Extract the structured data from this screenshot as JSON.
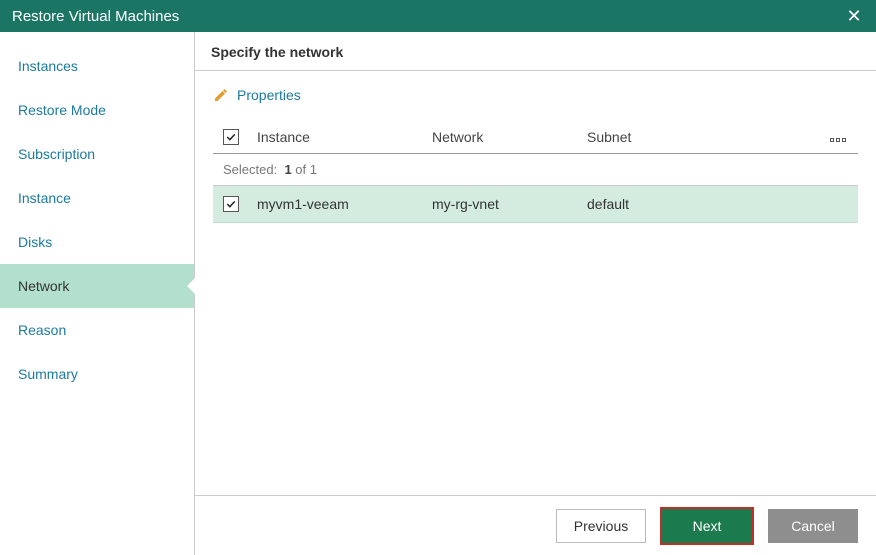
{
  "window": {
    "title": "Restore Virtual Machines"
  },
  "sidebar": {
    "items": [
      {
        "label": "Instances"
      },
      {
        "label": "Restore Mode"
      },
      {
        "label": "Subscription"
      },
      {
        "label": "Instance"
      },
      {
        "label": "Disks"
      },
      {
        "label": "Network"
      },
      {
        "label": "Reason"
      },
      {
        "label": "Summary"
      }
    ],
    "active_index": 5
  },
  "main": {
    "heading": "Specify the network",
    "properties_label": "Properties",
    "columns": {
      "instance": "Instance",
      "network": "Network",
      "subnet": "Subnet"
    },
    "selection": {
      "prefix": "Selected:",
      "count": "1",
      "of_word": "of",
      "total": "1"
    },
    "rows": [
      {
        "checked": true,
        "instance": "myvm1-veeam",
        "network": "my-rg-vnet",
        "subnet": "default"
      }
    ]
  },
  "footer": {
    "previous": "Previous",
    "next": "Next",
    "cancel": "Cancel"
  }
}
